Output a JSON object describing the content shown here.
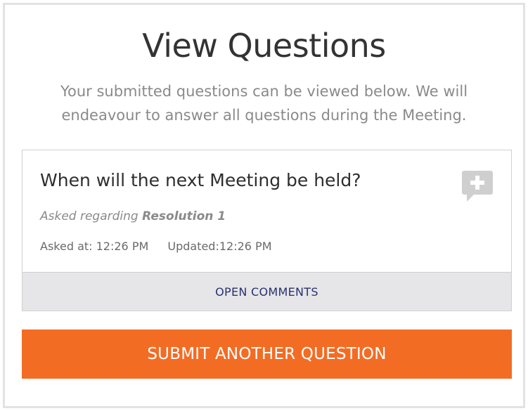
{
  "page": {
    "title": "View Questions",
    "subtitle": "Your submitted questions can be viewed below. We will endeavour to answer all questions during the Meeting."
  },
  "question": {
    "text": "When will the next Meeting be held?",
    "asked_regarding_prefix": "Asked regarding",
    "resolution": "Resolution 1",
    "asked_at": "Asked at: 12:26 PM",
    "updated_at": "Updated:12:26 PM",
    "icon": "add-comment-icon",
    "open_comments_label": "OPEN COMMENTS"
  },
  "actions": {
    "submit_another_label": "SUBMIT ANOTHER QUESTION"
  },
  "colors": {
    "accent": "#f36c24",
    "link": "#2a3170",
    "icon_gray": "#cfcfcf"
  }
}
